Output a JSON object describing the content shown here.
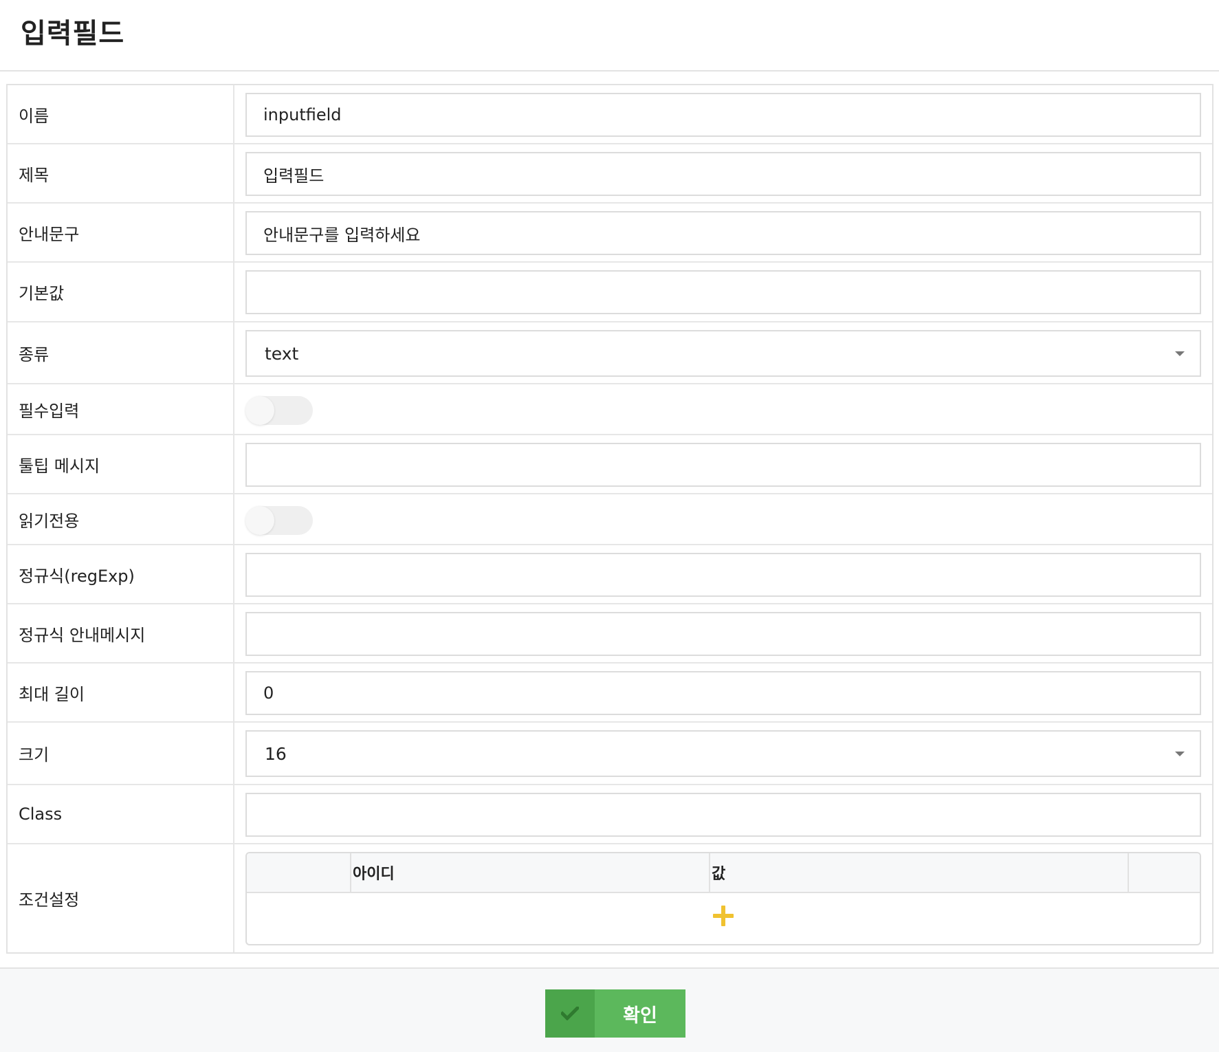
{
  "header": {
    "title": "입력필드"
  },
  "form": {
    "rows": [
      {
        "label": "이름",
        "value": "inputfield"
      },
      {
        "label": "제목",
        "value": "입력필드"
      },
      {
        "label": "안내문구",
        "value": "안내문구를 입력하세요"
      },
      {
        "label": "기본값",
        "value": ""
      },
      {
        "label": "종류",
        "value": "text"
      },
      {
        "label": "필수입력",
        "checked": false
      },
      {
        "label": "툴팁 메시지",
        "value": ""
      },
      {
        "label": "읽기전용",
        "checked": false
      },
      {
        "label": "정규식(regExp)",
        "value": ""
      },
      {
        "label": "정규식 안내메시지",
        "value": ""
      },
      {
        "label": "최대 길이",
        "value": "0"
      },
      {
        "label": "크기",
        "value": "16"
      },
      {
        "label": "Class",
        "value": ""
      },
      {
        "label": "조건설정"
      }
    ],
    "condition_table": {
      "columns": [
        "아이디",
        "값"
      ],
      "add_icon": "plus-icon",
      "add_icon_color": "#f0c230"
    }
  },
  "footer": {
    "confirm_label": "확인",
    "confirm_icon": "check-icon",
    "confirm_color": "#5cb85c"
  }
}
